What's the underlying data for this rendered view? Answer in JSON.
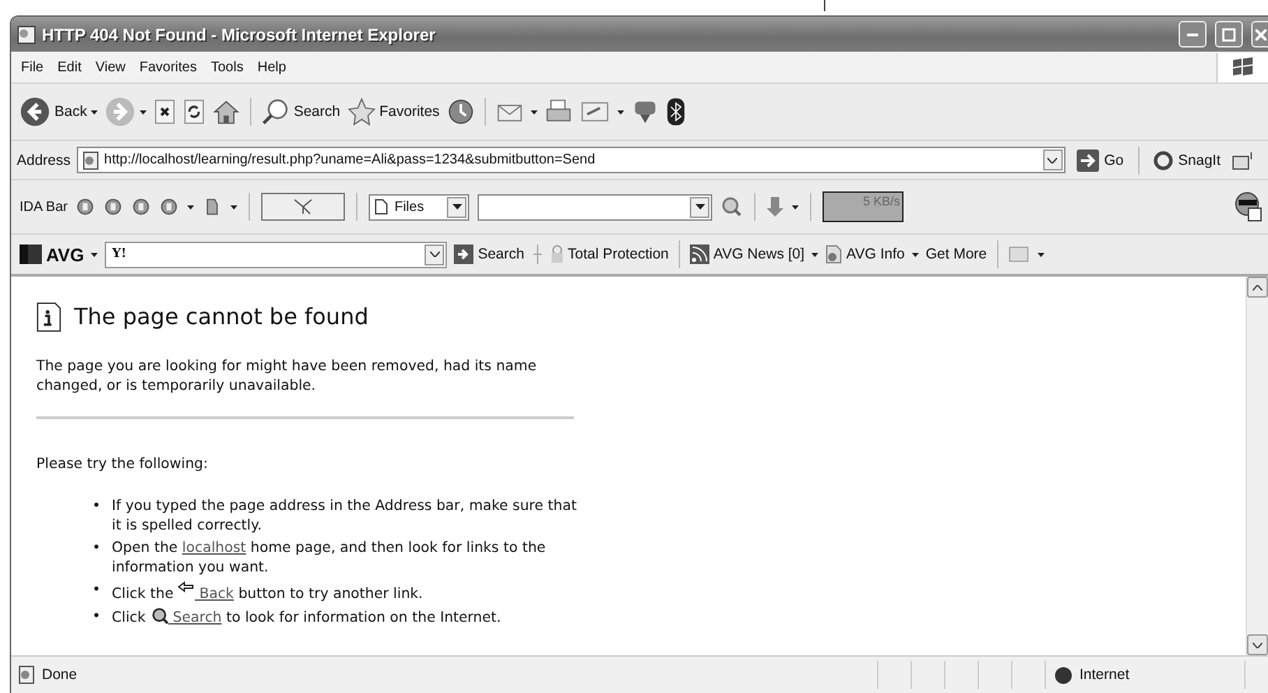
{
  "window": {
    "title": "HTTP 404 Not Found - Microsoft Internet Explorer"
  },
  "menu": [
    "File",
    "Edit",
    "View",
    "Favorites",
    "Tools",
    "Help"
  ],
  "toolbar": {
    "back": "Back",
    "search": "Search",
    "favorites": "Favorites"
  },
  "address": {
    "label": "Address",
    "url": "http://localhost/learning/result.php?uname=Ali&pass=1234&submitbutton=Send",
    "go": "Go",
    "snagit": "SnagIt"
  },
  "ida_bar": {
    "label": "IDA Bar",
    "files": "Files",
    "speed": "5 KB/s"
  },
  "avg_bar": {
    "logo": "AVG",
    "yahoo": "Y!",
    "search": "Search",
    "protection": "Total Protection",
    "news": "AVG News [0]",
    "info": "AVG Info",
    "more": "Get More"
  },
  "page": {
    "title": "The page cannot be found",
    "message": "The page you are looking for might have been removed, had its name changed, or is temporarily unavailable.",
    "prompt": "Please try the following:",
    "items": [
      {
        "marker": "•",
        "parts": [
          {
            "kind": "text",
            "text": "If you typed the page address in the Address bar, make sure that it is spelled correctly."
          }
        ]
      },
      {
        "marker": "•",
        "parts": [
          {
            "kind": "text",
            "text": "Open the "
          },
          {
            "kind": "link",
            "text": "localhost"
          },
          {
            "kind": "text",
            "text": " home page, and then look for links to the information you want."
          }
        ]
      },
      {
        "marker": "•",
        "parts": [
          {
            "kind": "text",
            "text": "Click the "
          },
          {
            "kind": "back_icon"
          },
          {
            "kind": "link",
            "text": " Back"
          },
          {
            "kind": "text",
            "text": " button to try another link."
          }
        ]
      },
      {
        "marker": "•",
        "parts": [
          {
            "kind": "text",
            "text": "Click "
          },
          {
            "kind": "search_icon"
          },
          {
            "kind": "link",
            "text": " Search"
          },
          {
            "kind": "text",
            "text": " to look for information on the Internet."
          }
        ]
      }
    ]
  },
  "status": {
    "text": "Done",
    "zone": "Internet"
  }
}
